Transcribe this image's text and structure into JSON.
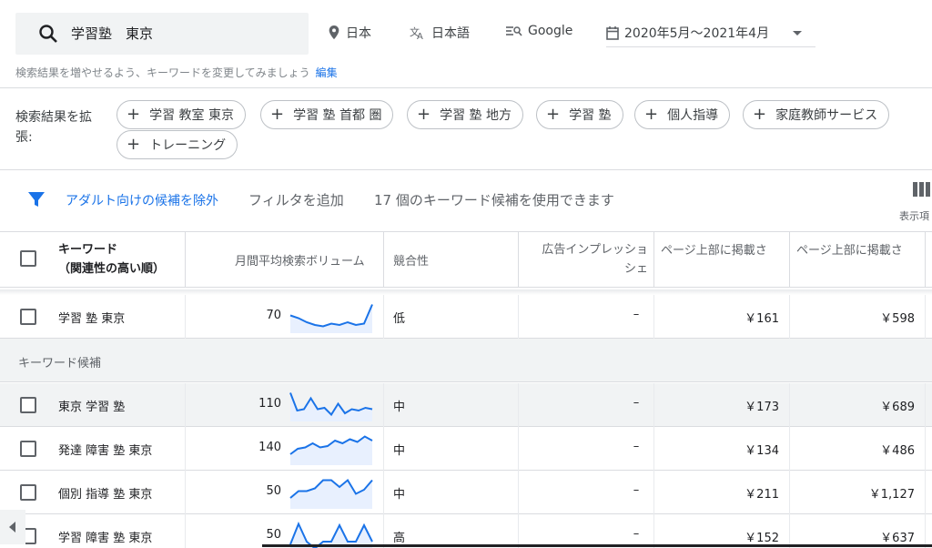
{
  "search": {
    "query": "学習塾　東京"
  },
  "top_chips": {
    "location": "日本",
    "language": "日本語",
    "network": "Google",
    "date_range": "2020年5月～2021年4月"
  },
  "suggestion": {
    "text": "検索結果を増やせるよう、キーワードを変更してみましょう",
    "edit_label": "編集"
  },
  "expand": {
    "label": "検索結果を拡張:",
    "chips": [
      "学習 教室 東京",
      "学習 塾 首都 圏",
      "学習 塾 地方",
      "学習 塾",
      "個人指導",
      "家庭教師サービス",
      "トレーニング"
    ]
  },
  "filterbar": {
    "adult_exclude": "アダルト向けの候補を除外",
    "add_filter": "フィルタを追加",
    "count_text": "17 個のキーワード候補を使用できます",
    "columns_label": "表示項"
  },
  "table": {
    "headers": {
      "keyword_line1": "キーワード",
      "keyword_line2": "（関連性の高い順）",
      "volume": "月間平均検索ボリューム",
      "competition": "競合性",
      "impression_line1": "広告インプレッショ",
      "impression_line2": "シェ",
      "low_bid": "ページ上部に掲載さ",
      "high_bid": "ページ上部に掲載さ"
    },
    "section_label": "キーワード候補",
    "searched_row": {
      "keyword": "学習 塾 東京",
      "volume": "70",
      "competition": "低",
      "impression": "–",
      "low": "￥161",
      "high": "￥598",
      "trend": [
        0.55,
        0.45,
        0.3,
        0.2,
        0.15,
        0.25,
        0.2,
        0.3,
        0.2,
        0.25,
        0.95
      ]
    },
    "rows": [
      {
        "keyword": "東京 学習 塾",
        "volume": "110",
        "competition": "中",
        "impression": "–",
        "low": "￥173",
        "high": "￥689",
        "trend": [
          0.95,
          0.3,
          0.35,
          0.75,
          0.35,
          0.4,
          0.15,
          0.55,
          0.2,
          0.35,
          0.3,
          0.4,
          0.35
        ]
      },
      {
        "keyword": "発達 障害 塾 東京",
        "volume": "140",
        "competition": "中",
        "impression": "–",
        "low": "￥134",
        "high": "￥486",
        "trend": [
          0.3,
          0.5,
          0.55,
          0.7,
          0.55,
          0.6,
          0.8,
          0.7,
          0.85,
          0.75,
          0.95,
          0.8
        ]
      },
      {
        "keyword": "個別 指導 塾 東京",
        "volume": "50",
        "competition": "中",
        "impression": "–",
        "low": "￥211",
        "high": "￥1,127",
        "trend": [
          0.3,
          0.55,
          0.55,
          0.65,
          0.95,
          0.95,
          0.7,
          0.95,
          0.45,
          0.6,
          0.95
        ]
      },
      {
        "keyword": "学習 障害 塾 東京",
        "volume": "50",
        "competition": "高",
        "impression": "–",
        "low": "￥152",
        "high": "￥637",
        "trend": [
          0.2,
          0.95,
          0.3,
          0.05,
          0.3,
          0.3,
          0.9,
          0.3,
          0.3,
          0.9,
          0.3
        ]
      }
    ]
  },
  "colors": {
    "accent": "#1a73e8",
    "spark_line": "#1a73e8",
    "spark_fill": "#e8f0fe",
    "grey_row": "#f1f3f4"
  }
}
